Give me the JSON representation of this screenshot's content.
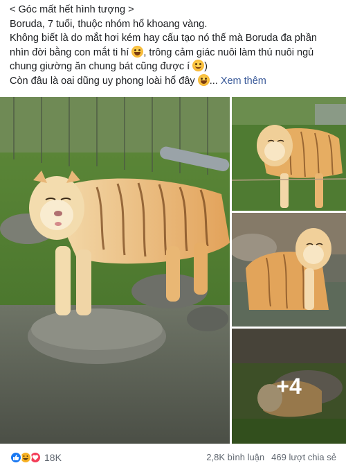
{
  "post": {
    "header_line": "< Góc mất hết hình tượng >",
    "line2": "Boruda, 7 tuổi, thuộc nhóm hổ khoang vàng.",
    "line3": "Không biết là do mắt hơi kém hay cấu tạo nó thế mà Boruda đa phần",
    "line4a": "nhìn đời bằng con mắt ti hí",
    "line4b": ", trông cảm giác nuôi làm thú nuôi ngủ",
    "line5a": "chung giường ăn chung bát cũng được í",
    "line5b": ")",
    "line6a": "Còn đâu là oai dũng uy phong loài hổ đây",
    "line6b": "...",
    "see_more": "Xem thêm"
  },
  "gallery": {
    "more_count": "+4"
  },
  "footer": {
    "reaction_count": "18K",
    "comments": "2,8K bình luận",
    "shares": "469 lượt chia sẻ"
  },
  "icons": {
    "reactions": [
      "like-icon",
      "haha-icon",
      "love-icon"
    ],
    "emoji_inline": [
      "grinning-emoji",
      "smiling-emoji",
      "laughing-emoji"
    ]
  },
  "colors": {
    "link": "#385898",
    "like": "#1877f2",
    "haha": "#f7b125",
    "love": "#f33e58",
    "meta_text": "#606770"
  }
}
